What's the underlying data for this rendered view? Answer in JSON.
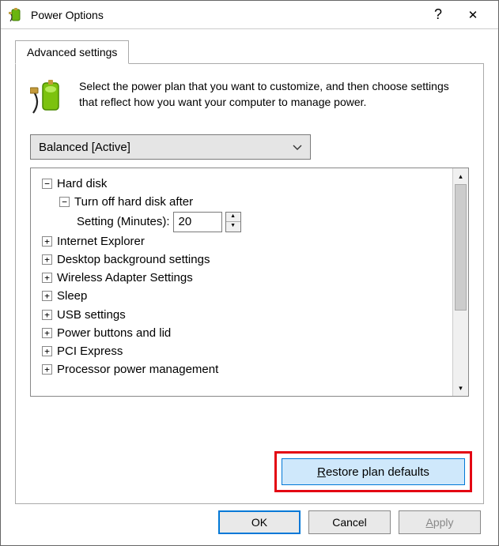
{
  "titlebar": {
    "title": "Power Options",
    "help": "?",
    "close": "✕"
  },
  "tab_label": "Advanced settings",
  "intro_text": "Select the power plan that you want to customize, and then choose settings that reflect how you want your computer to manage power.",
  "plan_selected": "Balanced [Active]",
  "tree": {
    "hard_disk": "Hard disk",
    "turn_off": "Turn off hard disk after",
    "setting_label": "Setting (Minutes):",
    "setting_value": "20",
    "ie": "Internet Explorer",
    "desktop_bg": "Desktop background settings",
    "wireless": "Wireless Adapter Settings",
    "sleep": "Sleep",
    "usb": "USB settings",
    "power_buttons": "Power buttons and lid",
    "pci": "PCI Express",
    "processor": "Processor power management"
  },
  "restore_prefix": "R",
  "restore_suffix": "estore plan defaults",
  "buttons": {
    "ok": "OK",
    "cancel": "Cancel",
    "apply_prefix": "A",
    "apply_suffix": "pply"
  }
}
